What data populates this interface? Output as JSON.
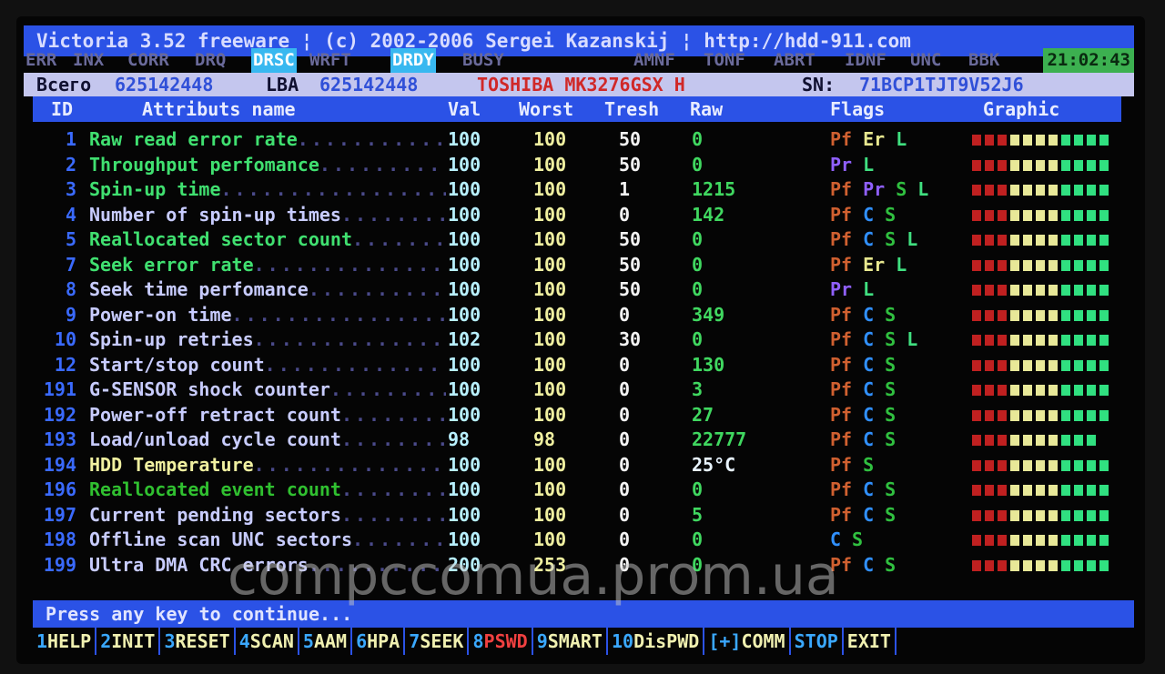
{
  "title": "Victoria 3.52 freeware ¦ (c) 2002-2006  Sergei Kazanskij  ¦ http://hdd-911.com",
  "status_flags": [
    {
      "label": "ERR",
      "active": false
    },
    {
      "label": "INX",
      "active": false
    },
    {
      "label": "CORR",
      "active": false
    },
    {
      "label": "DRQ",
      "active": false
    },
    {
      "label": "DRSC",
      "active": true
    },
    {
      "label": "WRFT",
      "active": false
    },
    {
      "label": "DRDY",
      "active": true
    },
    {
      "label": "BUSY",
      "active": false
    },
    {
      "label": "AMNF",
      "active": false
    },
    {
      "label": "TONF",
      "active": false
    },
    {
      "label": "ABRT",
      "active": false
    },
    {
      "label": "IDNF",
      "active": false
    },
    {
      "label": "UNC",
      "active": false
    },
    {
      "label": "BBK",
      "active": false
    }
  ],
  "time": "21:02:43",
  "info": {
    "total_label": "Всего",
    "total": "625142448",
    "lba_label": "LBA",
    "lba": "625142448",
    "model": "TOSHIBA MK3276GSX H",
    "sn_label": "SN:",
    "sn": "71BCP1TJT9V52J6"
  },
  "headers": {
    "id": "ID",
    "name": "Attributs name",
    "val": "Val",
    "worst": "Worst",
    "tresh": "Tresh",
    "raw": "Raw",
    "flags": "Flags",
    "graphic": "Graphic"
  },
  "colors": {
    "blue_bar": "#2b52e6",
    "info_bar": "#c4c6ee",
    "model": "#d02828",
    "green_name": "#40e070",
    "lavender_name": "#c8ccff",
    "yellow_name": "#f0f0a0",
    "dark_green_name": "#30c030",
    "Pf": "#d06030",
    "Er": "#e8e890",
    "L": "#40e080",
    "Pr": "#9060ff",
    "S": "#30c040",
    "C": "#3090ff",
    "bar_red": "#c02020",
    "bar_yellow": "#e8e898",
    "bar_green": "#30e080"
  },
  "rows": [
    {
      "id": "1",
      "name": "Raw read error rate",
      "color": "green_name",
      "val": "100",
      "worst": "100",
      "tresh": "50",
      "raw": "0",
      "flags": [
        "Pf",
        "Er",
        "L"
      ],
      "bars": 11
    },
    {
      "id": "2",
      "name": "Throughput perfomance",
      "color": "green_name",
      "val": "100",
      "worst": "100",
      "tresh": "50",
      "raw": "0",
      "flags": [
        "Pr",
        "L"
      ],
      "bars": 11
    },
    {
      "id": "3",
      "name": "Spin-up time",
      "color": "green_name",
      "val": "100",
      "worst": "100",
      "tresh": "1",
      "raw": "1215",
      "flags": [
        "Pf",
        "Pr",
        "S",
        "L"
      ],
      "bars": 11
    },
    {
      "id": "4",
      "name": "Number of spin-up times",
      "color": "lavender_name",
      "val": "100",
      "worst": "100",
      "tresh": "0",
      "raw": "142",
      "flags": [
        "Pf",
        "C",
        "S"
      ],
      "bars": 11
    },
    {
      "id": "5",
      "name": "Reallocated sector count",
      "color": "green_name",
      "val": "100",
      "worst": "100",
      "tresh": "50",
      "raw": "0",
      "flags": [
        "Pf",
        "C",
        "S",
        "L"
      ],
      "bars": 11
    },
    {
      "id": "7",
      "name": "Seek error rate",
      "color": "green_name",
      "val": "100",
      "worst": "100",
      "tresh": "50",
      "raw": "0",
      "flags": [
        "Pf",
        "Er",
        "L"
      ],
      "bars": 11
    },
    {
      "id": "8",
      "name": "Seek time perfomance",
      "color": "lavender_name",
      "val": "100",
      "worst": "100",
      "tresh": "50",
      "raw": "0",
      "flags": [
        "Pr",
        "L"
      ],
      "bars": 11
    },
    {
      "id": "9",
      "name": "Power-on time",
      "color": "lavender_name",
      "val": "100",
      "worst": "100",
      "tresh": "0",
      "raw": "349",
      "flags": [
        "Pf",
        "C",
        "S"
      ],
      "bars": 11
    },
    {
      "id": "10",
      "name": "Spin-up retries",
      "color": "lavender_name",
      "val": "102",
      "worst": "100",
      "tresh": "30",
      "raw": "0",
      "flags": [
        "Pf",
        "C",
        "S",
        "L"
      ],
      "bars": 11
    },
    {
      "id": "12",
      "name": "Start/stop count",
      "color": "lavender_name",
      "val": "100",
      "worst": "100",
      "tresh": "0",
      "raw": "130",
      "flags": [
        "Pf",
        "C",
        "S"
      ],
      "bars": 11
    },
    {
      "id": "191",
      "name": "G-SENSOR shock counter",
      "color": "lavender_name",
      "val": "100",
      "worst": "100",
      "tresh": "0",
      "raw": "3",
      "flags": [
        "Pf",
        "C",
        "S"
      ],
      "bars": 11
    },
    {
      "id": "192",
      "name": "Power-off retract count",
      "color": "lavender_name",
      "val": "100",
      "worst": "100",
      "tresh": "0",
      "raw": "27",
      "flags": [
        "Pf",
        "C",
        "S"
      ],
      "bars": 11
    },
    {
      "id": "193",
      "name": "Load/unload cycle count",
      "color": "lavender_name",
      "val": "98",
      "worst": "98",
      "tresh": "0",
      "raw": "22777",
      "flags": [
        "Pf",
        "C",
        "S"
      ],
      "bars": 10
    },
    {
      "id": "194",
      "name": "HDD Temperature",
      "color": "yellow_name",
      "val": "100",
      "worst": "100",
      "tresh": "0",
      "raw": "25°C",
      "flags": [
        "Pf",
        "S"
      ],
      "bars": 11
    },
    {
      "id": "196",
      "name": "Reallocated event count",
      "color": "dark_green_name",
      "val": "100",
      "worst": "100",
      "tresh": "0",
      "raw": "0",
      "flags": [
        "Pf",
        "C",
        "S"
      ],
      "bars": 11
    },
    {
      "id": "197",
      "name": "Current pending sectors",
      "color": "lavender_name",
      "val": "100",
      "worst": "100",
      "tresh": "0",
      "raw": "5",
      "flags": [
        "Pf",
        "C",
        "S"
      ],
      "bars": 11
    },
    {
      "id": "198",
      "name": "Offline scan UNC sectors",
      "color": "lavender_name",
      "val": "100",
      "worst": "100",
      "tresh": "0",
      "raw": "0",
      "flags": [
        "C",
        "S"
      ],
      "bars": 11
    },
    {
      "id": "199",
      "name": "Ultra DMA CRC errors",
      "color": "lavender_name",
      "val": "200",
      "worst": "253",
      "tresh": "0",
      "raw": "0",
      "flags": [
        "Pf",
        "C",
        "S"
      ],
      "bars": 11
    }
  ],
  "prompt": "Press any key to continue...",
  "fkeys": [
    {
      "n": "1",
      "l": "HELP"
    },
    {
      "n": "2",
      "l": "INIT"
    },
    {
      "n": "3",
      "l": "RESET"
    },
    {
      "n": "4",
      "l": "SCAN"
    },
    {
      "n": "5",
      "l": "AAM"
    },
    {
      "n": "6",
      "l": "HPA"
    },
    {
      "n": "7",
      "l": "SEEK"
    },
    {
      "n": "8",
      "l": "PSWD",
      "red": true
    },
    {
      "n": "9",
      "l": "SMART"
    },
    {
      "n": "10",
      "l": "DisPWD"
    },
    {
      "n": "[+]",
      "l": "COMM"
    },
    {
      "n": "STOP",
      "l": ""
    },
    {
      "n": "",
      "l": "EXIT"
    }
  ],
  "watermark": "compccomua.prom.ua"
}
